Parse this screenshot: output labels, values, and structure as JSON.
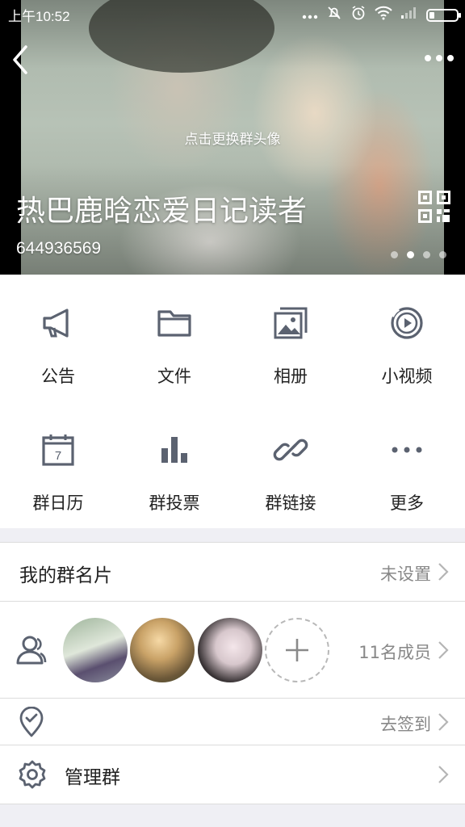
{
  "status_bar": {
    "time": "上午10:52"
  },
  "header": {
    "change_avatar_hint": "点击更换群头像",
    "group_name": "热巴鹿晗恋爱日记读者",
    "group_id": "644936569",
    "carousel_pages": 4,
    "carousel_active_index": 1
  },
  "features": [
    {
      "label": "公告",
      "icon": "megaphone-icon"
    },
    {
      "label": "文件",
      "icon": "folder-icon"
    },
    {
      "label": "相册",
      "icon": "photo-album-icon"
    },
    {
      "label": "小视频",
      "icon": "video-play-icon"
    },
    {
      "label": "群日历",
      "icon": "calendar-icon",
      "calendar_day": "7"
    },
    {
      "label": "群投票",
      "icon": "bar-chart-icon"
    },
    {
      "label": "群链接",
      "icon": "link-icon"
    },
    {
      "label": "更多",
      "icon": "more-dots-icon"
    }
  ],
  "card": {
    "title": "我的群名片",
    "value": "未设置"
  },
  "members": {
    "count_label": "11名成员"
  },
  "checkin": {
    "value": "去签到"
  },
  "manage": {
    "title": "管理群"
  },
  "colors": {
    "icon_gray": "#5b6270",
    "text_primary": "#222222",
    "text_secondary": "#888888",
    "divider": "#dcdcdc",
    "background": "#efeff4"
  }
}
